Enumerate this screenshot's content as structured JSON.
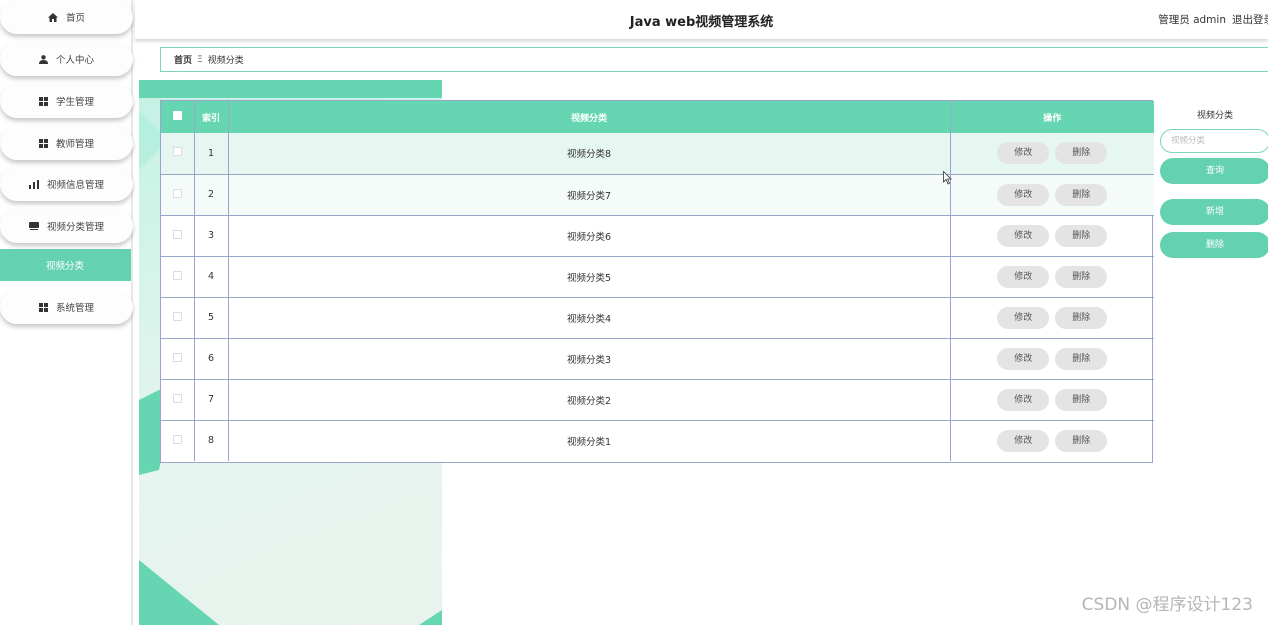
{
  "sidebar": {
    "items": [
      {
        "label": "首页",
        "icon": "home-icon"
      },
      {
        "label": "个人中心",
        "icon": "user-icon"
      },
      {
        "label": "学生管理",
        "icon": "grid-icon"
      },
      {
        "label": "教师管理",
        "icon": "grid-icon"
      },
      {
        "label": "视频信息管理",
        "icon": "bar-chart-icon"
      },
      {
        "label": "视频分类管理",
        "icon": "card-icon"
      },
      {
        "label": "系统管理",
        "icon": "grid-icon"
      }
    ],
    "active_sub": "视频分类"
  },
  "header": {
    "title": "Java web视频管理系统",
    "user_label": "管理员 admin",
    "logout": "退出登录"
  },
  "breadcrumb": {
    "home": "首页",
    "separator": "Ξ",
    "current": "视频分类"
  },
  "table": {
    "columns": [
      "索引",
      "视频分类",
      "操作"
    ],
    "edit_label": "修改",
    "delete_label": "删除",
    "rows": [
      {
        "index": "1",
        "category": "视频分类8"
      },
      {
        "index": "2",
        "category": "视频分类7"
      },
      {
        "index": "3",
        "category": "视频分类6"
      },
      {
        "index": "4",
        "category": "视频分类5"
      },
      {
        "index": "5",
        "category": "视频分类4"
      },
      {
        "index": "6",
        "category": "视频分类3"
      },
      {
        "index": "7",
        "category": "视频分类2"
      },
      {
        "index": "8",
        "category": "视频分类1"
      }
    ]
  },
  "search": {
    "label": "视频分类",
    "placeholder": "视频分类",
    "query_button": "查询",
    "add_button": "新增",
    "delete_button": "删除"
  },
  "watermark": "CSDN @程序设计123",
  "colors": {
    "accent": "#64d1b0",
    "table_border": "#9aa6c9"
  }
}
